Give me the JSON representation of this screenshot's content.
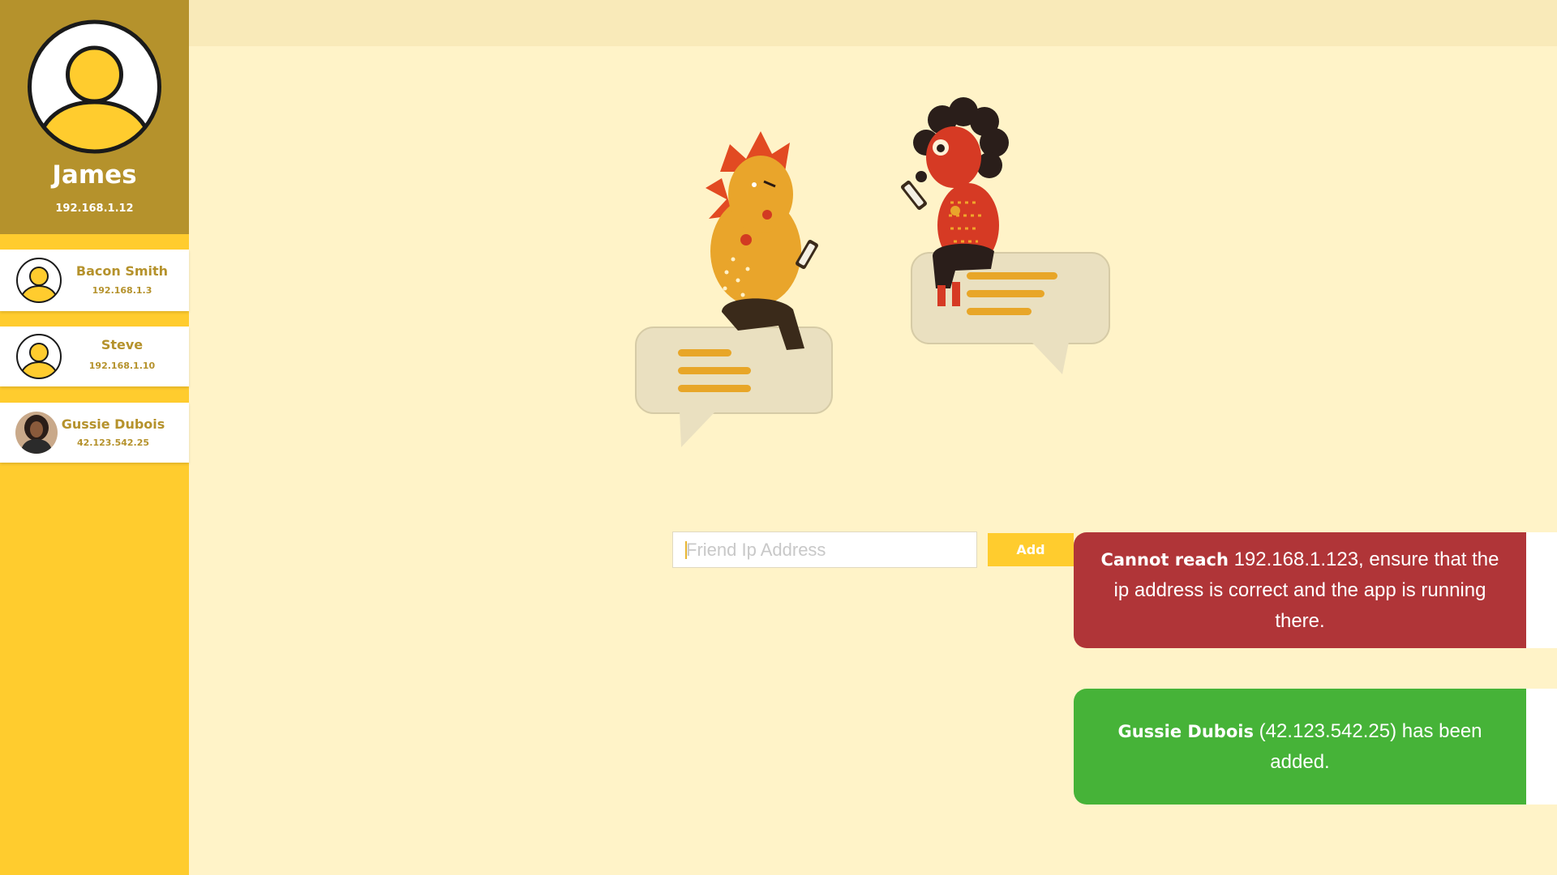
{
  "user": {
    "name": "James",
    "ip": "192.168.1.12"
  },
  "friends": [
    {
      "name": "Bacon Smith",
      "ip": "192.168.1.3",
      "avatar": "default-avatar-icon"
    },
    {
      "name": "Steve",
      "ip": "192.168.1.10",
      "avatar": "default-avatar-icon"
    },
    {
      "name": "Gussie Dubois",
      "ip": "42.123.542.25",
      "avatar": "photo-avatar"
    }
  ],
  "add_friend": {
    "placeholder": "Friend Ip Address",
    "value": "",
    "button_label": "Add"
  },
  "toasts": {
    "error": {
      "strong": "Cannot reach",
      "text": " 192.168.1.123, ensure that the ip address is correct and the app is running there."
    },
    "success": {
      "strong": "Gussie Dubois",
      "text": " (42.123.542.25) has been added."
    }
  },
  "colors": {
    "sidebar": "#FFCC2E",
    "profile_header": "#B5922C",
    "main_background": "#FFF3C8",
    "topbar": "#F9EAB9",
    "error": "#B03538",
    "success": "#46B338"
  }
}
